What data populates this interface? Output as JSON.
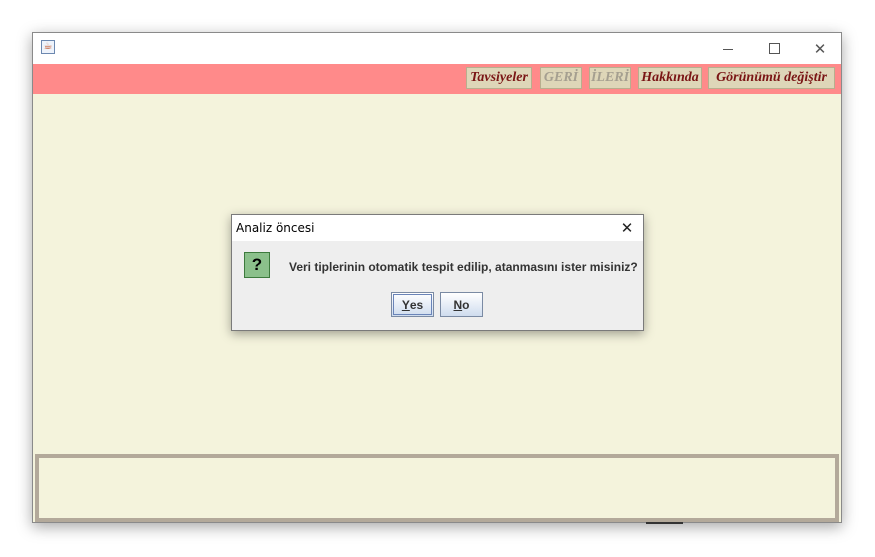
{
  "window": {
    "app_icon": "java-coffee-icon",
    "controls": {
      "minimize": "minimize-icon",
      "maximize": "maximize-icon",
      "close": "close-icon"
    }
  },
  "toolbar": {
    "background": "#ff8a8a",
    "buttons": [
      {
        "label": "Tavsiyeler",
        "enabled": true
      },
      {
        "label": "GERİ",
        "enabled": false
      },
      {
        "label": "İLERİ",
        "enabled": false
      },
      {
        "label": "Hakkında",
        "enabled": true
      },
      {
        "label": "Görünümü değiştir",
        "enabled": true
      }
    ]
  },
  "dialog": {
    "title": "Analiz öncesi",
    "icon": "question-icon",
    "message": "Veri tiplerinin otomatik tespit edilip, atanmasını ister misiniz?",
    "yes_mnemonic": "Y",
    "yes_rest": "es",
    "no_mnemonic": "N",
    "no_rest": "o"
  },
  "colors": {
    "content_bg": "#f4f3dc",
    "toolbar_text": "#7a1515",
    "question_icon_bg": "#8bc08b"
  }
}
